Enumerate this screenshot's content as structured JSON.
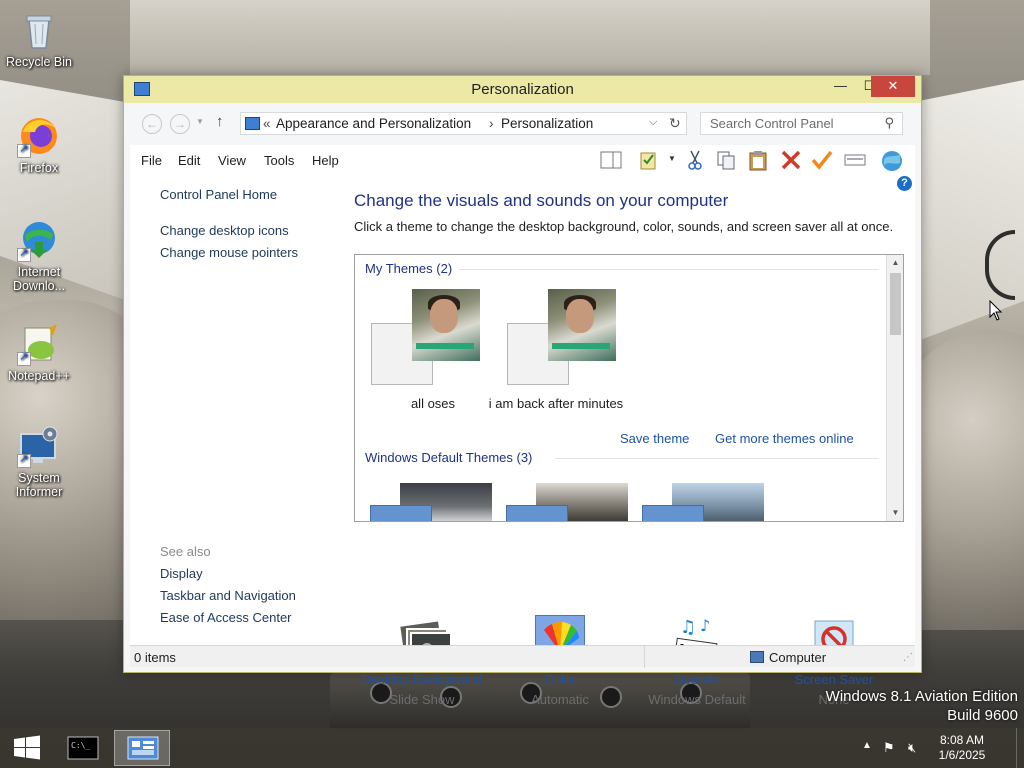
{
  "desktop": {
    "icons": [
      {
        "label": "Recycle Bin",
        "icon": "recycle-bin-icon"
      },
      {
        "label": "Firefox",
        "icon": "firefox-icon"
      },
      {
        "label": "Internet Downlo...",
        "icon": "internet-download-manager-icon"
      },
      {
        "label": "Notepad++",
        "icon": "notepad-plus-plus-icon"
      },
      {
        "label": "System Informer",
        "icon": "system-informer-icon"
      }
    ],
    "watermark": {
      "line1": "Windows 8.1 Aviation Edition",
      "line2": "Build 9600"
    }
  },
  "window": {
    "title": "Personalization",
    "controls": {
      "minimize": "—",
      "maximize": "☐",
      "close": "✕"
    },
    "address": {
      "prefix": "«",
      "crumbs": [
        "Appearance and Personalization",
        "Personalization"
      ],
      "separator": "›"
    },
    "search": {
      "placeholder": "Search Control Panel"
    },
    "menu": [
      "File",
      "Edit",
      "View",
      "Tools",
      "Help"
    ],
    "left_pane": {
      "links": [
        "Control Panel Home",
        "Change desktop icons",
        "Change mouse pointers"
      ],
      "see_also_label": "See also",
      "see_also": [
        "Display",
        "Taskbar and Navigation",
        "Ease of Access Center"
      ]
    },
    "main": {
      "heading": "Change the visuals and sounds on your computer",
      "subtext": "Click a theme to change the desktop background, color, sounds, and screen saver all at once.",
      "my_themes_header": "My Themes (2)",
      "my_themes": [
        {
          "name": "all oses"
        },
        {
          "name": "i am back after minutes"
        }
      ],
      "save_theme": "Save theme",
      "get_more": "Get more themes online",
      "default_themes_header": "Windows Default Themes (3)"
    },
    "bottom": [
      {
        "name": "Desktop Background",
        "value": "Slide Show",
        "icon": "desktop-background-icon"
      },
      {
        "name": "Color",
        "value": "Automatic",
        "icon": "color-fan-icon"
      },
      {
        "name": "Sounds",
        "value": "Windows Default",
        "icon": "sounds-music-icon"
      },
      {
        "name": "Screen Saver",
        "value": "None",
        "icon": "screen-saver-icon"
      }
    ],
    "status": {
      "items": "0 items",
      "location": "Computer"
    }
  },
  "taskbar": {
    "clock": {
      "time": "8:08 AM",
      "date": "1/6/2025"
    }
  },
  "colors": {
    "title_bar": "#ece9a6",
    "window_border": "#b9b26a",
    "link": "#1e52a5",
    "heading": "#1e3287",
    "close": "#c7463e"
  }
}
